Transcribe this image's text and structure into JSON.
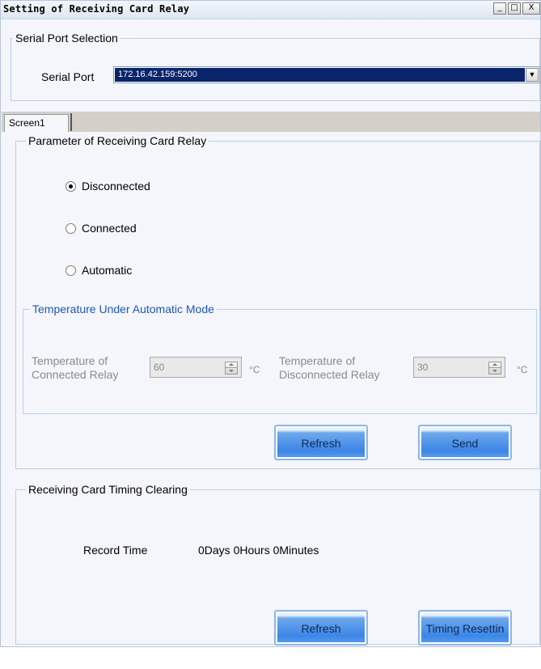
{
  "window": {
    "title": "Setting of Receiving Card Relay",
    "controls": {
      "minimize": "_",
      "maximize": "□",
      "close": "X"
    }
  },
  "serial_port": {
    "group_title": "Serial Port Selection",
    "label": "Serial Port",
    "selected_value": "172.16.42.159:5200"
  },
  "tabs": [
    {
      "label": "Screen1",
      "active": true
    }
  ],
  "relay": {
    "group_title": "Parameter of Receiving Card Relay",
    "options": [
      {
        "label": "Disconnected",
        "checked": true
      },
      {
        "label": "Connected",
        "checked": false
      },
      {
        "label": "Automatic",
        "checked": false
      }
    ],
    "auto_mode": {
      "group_title": "Temperature Under Automatic Mode",
      "connected_label_line1": "Temperature of",
      "connected_label_line2": "Connected Relay",
      "connected_value": "60",
      "disconnected_label_line1": "Temperature of",
      "disconnected_label_line2": "Disconnected Relay",
      "disconnected_value": "30",
      "unit": "°C"
    },
    "refresh_label": "Refresh",
    "send_label": "Send"
  },
  "timing": {
    "group_title": "Receiving Card Timing Clearing",
    "record_time_label": "Record Time",
    "record_time_value": "0Days 0Hours 0Minutes",
    "refresh_label": "Refresh",
    "reset_label": "Timing Resettin"
  },
  "colors": {
    "selection": "#0a246a",
    "group_border": "#b7d0ea",
    "auto_group_title": "#1f57b4",
    "button_blue": "#3c86e6"
  }
}
